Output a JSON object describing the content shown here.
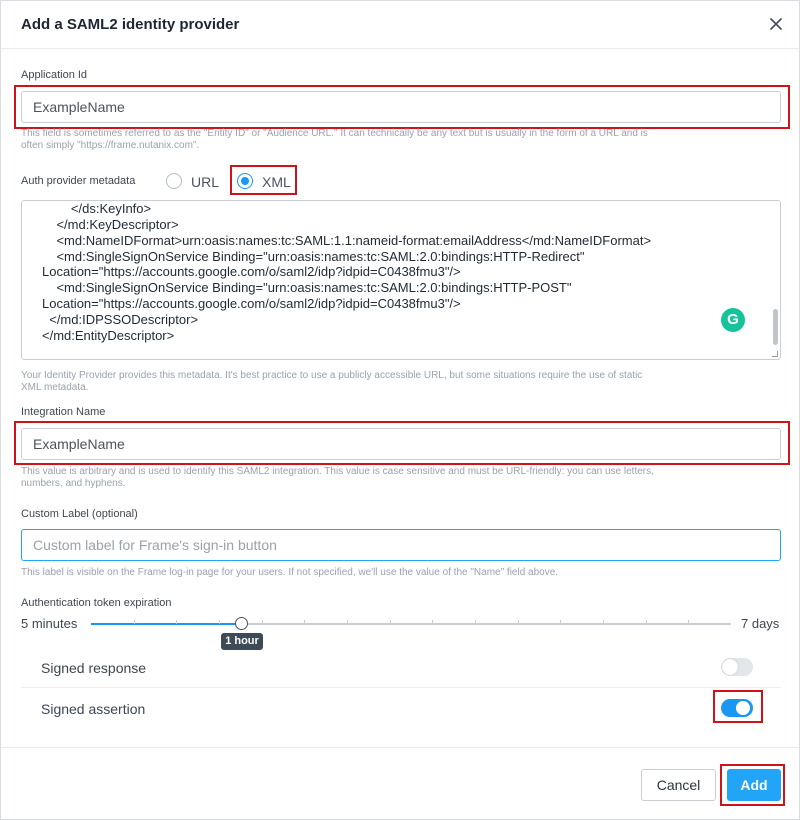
{
  "dialog": {
    "title": "Add a SAML2 identity provider"
  },
  "application_id": {
    "label": "Application Id",
    "value": "ExampleName",
    "help_line1": "This field is sometimes referred to as the \"Entity ID\" or \"Audience URL.\" It can technically be any text but is usually in the form of a URL and is",
    "help_line2": "often simply \"https://frame.nutanix.com\"."
  },
  "auth_metadata": {
    "label": "Auth provider metadata",
    "options": [
      "URL",
      "XML"
    ],
    "selected": "XML",
    "xml_lines": [
      "        </ds:KeyInfo>",
      "    </md:KeyDescriptor>",
      "    <md:NameIDFormat>urn:oasis:names:tc:SAML:1.1:nameid-format:emailAddress</md:NameIDFormat>",
      "    <md:SingleSignOnService Binding=\"urn:oasis:names:tc:SAML:2.0:bindings:HTTP-Redirect\"",
      "Location=\"https://accounts.google.com/o/saml2/idp?idpid=C0438fmu3\"/>",
      "    <md:SingleSignOnService Binding=\"urn:oasis:names:tc:SAML:2.0:bindings:HTTP-POST\"",
      "Location=\"https://accounts.google.com/o/saml2/idp?idpid=C0438fmu3\"/>",
      "  </md:IDPSSODescriptor>",
      "</md:EntityDescriptor>"
    ],
    "help_line1": "Your Identity Provider provides this metadata. It's best practice to use a publicly accessible URL, but some situations require the use of static",
    "help_line2": "XML metadata."
  },
  "integration_name": {
    "label": "Integration Name",
    "value": "ExampleName",
    "help_line1": "This value is arbitrary and is used to identify this SAML2 integration. This value is case sensitive and must be URL-friendly: you can use letters,",
    "help_line2": "numbers, and hyphens."
  },
  "custom_label": {
    "label": "Custom Label (optional)",
    "placeholder": "Custom label for Frame's sign-in button",
    "value": "",
    "help": "This label is visible on the Frame log-in page for your users. If not specified, we'll use the value of the \"Name\" field above."
  },
  "token_expiration": {
    "label": "Authentication token expiration",
    "min_label": "5 minutes",
    "max_label": "7 days",
    "value_label": "1 hour",
    "tick_count": 15,
    "selected_tick": 4
  },
  "toggles": {
    "signed_response": {
      "label": "Signed response",
      "on": false
    },
    "signed_assertion": {
      "label": "Signed assertion",
      "on": true
    }
  },
  "footer": {
    "cancel_label": "Cancel",
    "add_label": "Add"
  },
  "colors": {
    "accent": "#1a97f0",
    "highlight_box": "#d0121b",
    "grammarly": "#15c39a"
  }
}
